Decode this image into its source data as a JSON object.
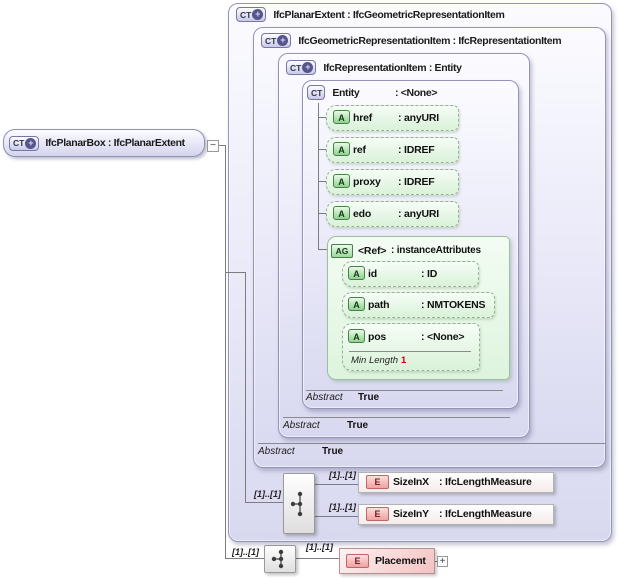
{
  "icons": {
    "ct": "CT",
    "a": "A",
    "ag": "AG",
    "e": "E",
    "plus": "+",
    "minus": "−"
  },
  "root_box": {
    "title": "IfcPlanarBox : IfcPlanarExtent"
  },
  "box_planar_extent": {
    "title": "IfcPlanarExtent : IfcGeometricRepresentationItem"
  },
  "box_geom_rep": {
    "title": "IfcGeometricRepresentationItem : IfcRepresentationItem",
    "abstract_label": "Abstract",
    "abstract_value": "True"
  },
  "box_rep_item": {
    "title": "IfcRepresentationItem : Entity",
    "abstract_label": "Abstract",
    "abstract_value": "True"
  },
  "box_entity": {
    "name": "Entity",
    "type": ": <None>",
    "abstract_label": "Abstract",
    "abstract_value": "True"
  },
  "entity_attrs": [
    {
      "name": "href",
      "type": ": anyURI"
    },
    {
      "name": "ref",
      "type": ": IDREF"
    },
    {
      "name": "proxy",
      "type": ": IDREF"
    },
    {
      "name": "edo",
      "type": ": anyURI"
    }
  ],
  "ref_group": {
    "name": "<Ref>",
    "type": ": instanceAttributes",
    "attrs": [
      {
        "name": "id",
        "type": ": ID"
      },
      {
        "name": "path",
        "type": ": NMTOKENS"
      },
      {
        "name": "pos",
        "type": ": <None>",
        "facet_label": "Min Length",
        "facet_value": "1"
      }
    ]
  },
  "sequence1": {
    "card": "[1]..[1]",
    "elements": [
      {
        "card": "[1]..[1]",
        "name": "SizeInX",
        "type": ": IfcLengthMeasure"
      },
      {
        "card": "[1]..[1]",
        "name": "SizeInY",
        "type": ": IfcLengthMeasure"
      }
    ]
  },
  "sequence2": {
    "card": "[1]..[1]",
    "element_card": "[1]..[1]",
    "element": {
      "name": "Placement"
    }
  }
}
